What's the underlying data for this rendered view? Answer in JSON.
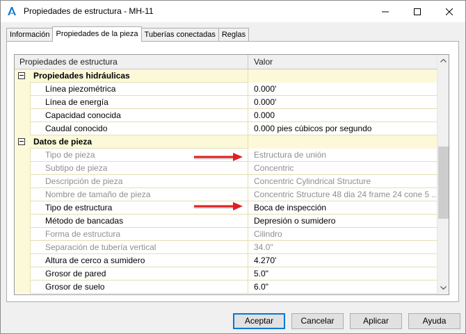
{
  "window": {
    "title": "Propiedades de estructura - MH-11"
  },
  "tabs": [
    {
      "label": "Información",
      "active": false
    },
    {
      "label": "Propiedades de la pieza",
      "active": true
    },
    {
      "label": "Tuberías conectadas",
      "active": false
    },
    {
      "label": "Reglas",
      "active": false
    }
  ],
  "grid": {
    "col_property": "Propiedades de estructura",
    "col_value": "Valor",
    "rows": [
      {
        "type": "category",
        "name": "Propiedades hidráulicas",
        "value": ""
      },
      {
        "type": "prop",
        "name": "Línea piezométrica",
        "value": "0.000'",
        "readonly": false
      },
      {
        "type": "prop",
        "name": "Línea de energía",
        "value": "0.000'",
        "readonly": false
      },
      {
        "type": "prop",
        "name": "Capacidad conocida",
        "value": "0.000",
        "readonly": false
      },
      {
        "type": "prop",
        "name": "Caudal conocido",
        "value": "0.000 pies cúbicos por segundo",
        "readonly": false
      },
      {
        "type": "category",
        "name": "Datos de pieza",
        "value": ""
      },
      {
        "type": "prop",
        "name": "Tipo de pieza",
        "value": "Estructura de unión",
        "readonly": true
      },
      {
        "type": "prop",
        "name": "Subtipo de pieza",
        "value": "Concentric",
        "readonly": true
      },
      {
        "type": "prop",
        "name": "Descripción de pieza",
        "value": "Concentric Cylindrical Structure",
        "readonly": true
      },
      {
        "type": "prop",
        "name": "Nombre de tamaño de pieza",
        "value": "Concentric Structure 48 dia 24 frame 24 cone 5 ...",
        "readonly": true
      },
      {
        "type": "prop",
        "name": "Tipo de estructura",
        "value": "Boca de inspección",
        "readonly": false
      },
      {
        "type": "prop",
        "name": "Método de bancadas",
        "value": "Depresión o sumidero",
        "readonly": false
      },
      {
        "type": "prop",
        "name": "Forma de estructura",
        "value": "Cilindro",
        "readonly": true
      },
      {
        "type": "prop",
        "name": "Separación de tubería vertical",
        "value": "34.0\"",
        "readonly": true
      },
      {
        "type": "prop",
        "name": "Altura de cerco a sumidero",
        "value": "4.270'",
        "readonly": false
      },
      {
        "type": "prop",
        "name": "Grosor de pared",
        "value": "5.0\"",
        "readonly": false
      },
      {
        "type": "prop",
        "name": "Grosor de suelo",
        "value": "6.0\"",
        "readonly": false
      }
    ]
  },
  "buttons": {
    "ok": "Aceptar",
    "cancel": "Cancelar",
    "apply": "Aplicar",
    "help": "Ayuda"
  },
  "colors": {
    "grid_row_bg": "#fcf9d9",
    "readonly_text": "#8f8f8f",
    "arrow": "#e02020",
    "default_button_border": "#0078d7"
  }
}
